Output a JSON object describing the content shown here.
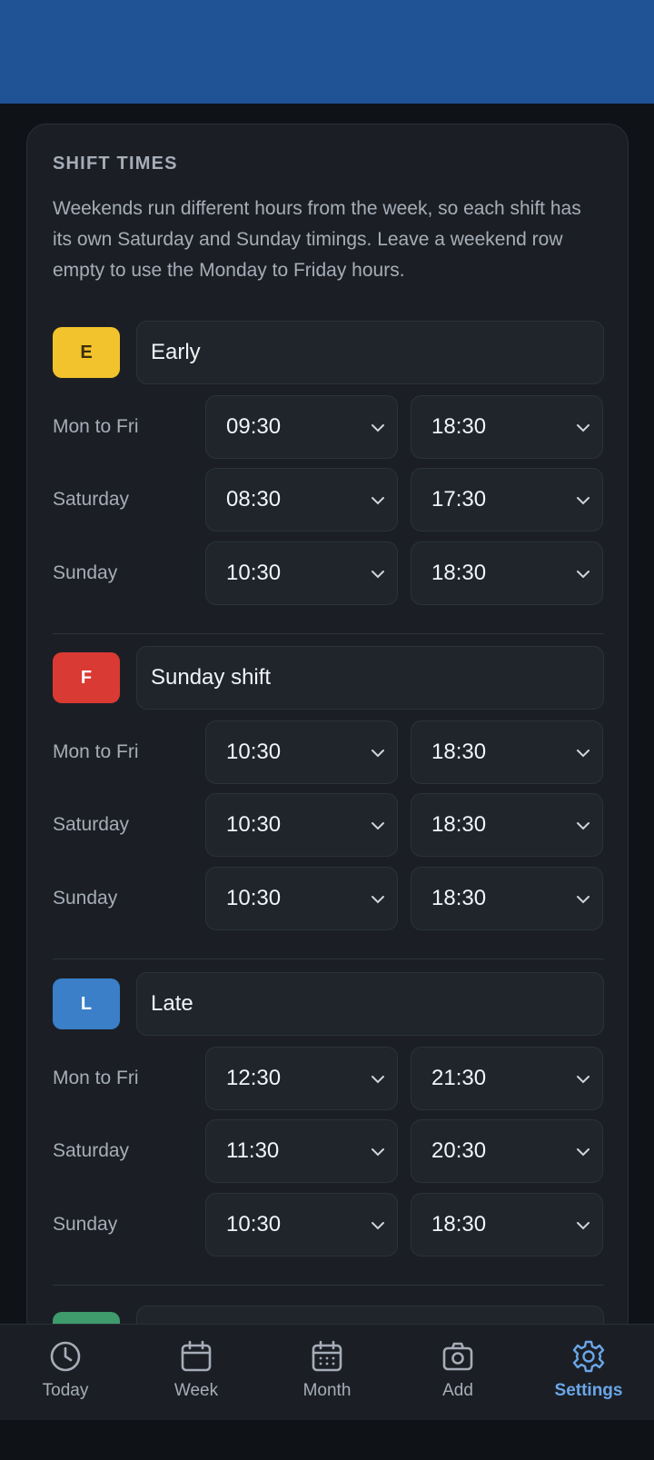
{
  "section": {
    "title": "SHIFT TIMES",
    "description": "Weekends run different hours from the week, so each shift has its own Saturday and Sunday timings. Leave a weekend row empty to use the Monday to Friday hours."
  },
  "shifts": [
    {
      "code": "E",
      "name": "Early",
      "badge_color": "#f2c32c",
      "badge_text_color": "#3a2f0a",
      "rows": [
        {
          "label": "Mon to Fri",
          "start": "09:30",
          "end": "18:30"
        },
        {
          "label": "Saturday",
          "start": "08:30",
          "end": "17:30"
        },
        {
          "label": "Sunday",
          "start": "10:30",
          "end": "18:30"
        }
      ]
    },
    {
      "code": "F",
      "name": "Sunday shift",
      "badge_color": "#d93a33",
      "badge_text_color": "#ffffff",
      "rows": [
        {
          "label": "Mon to Fri",
          "start": "10:30",
          "end": "18:30"
        },
        {
          "label": "Saturday",
          "start": "10:30",
          "end": "18:30"
        },
        {
          "label": "Sunday",
          "start": "10:30",
          "end": "18:30"
        }
      ]
    },
    {
      "code": "L",
      "name": "Late",
      "badge_color": "#3a7fc8",
      "badge_text_color": "#ffffff",
      "rows": [
        {
          "label": "Mon to Fri",
          "start": "12:30",
          "end": "21:30"
        },
        {
          "label": "Saturday",
          "start": "11:30",
          "end": "20:30"
        },
        {
          "label": "Sunday",
          "start": "10:30",
          "end": "18:30"
        }
      ]
    }
  ],
  "partial_next_shift": {
    "badge_color": "#3f9a6c"
  },
  "nav": [
    {
      "label": "Today",
      "icon": "clock-icon",
      "active": false
    },
    {
      "label": "Week",
      "icon": "calendar-week-icon",
      "active": false
    },
    {
      "label": "Month",
      "icon": "calendar-month-icon",
      "active": false
    },
    {
      "label": "Add",
      "icon": "camera-icon",
      "active": false
    },
    {
      "label": "Settings",
      "icon": "gear-icon",
      "active": true
    }
  ],
  "colors": {
    "app_bar": "#1f5396",
    "background": "#0f1318",
    "card": "#1b1f25",
    "accent": "#6aa6e8"
  }
}
